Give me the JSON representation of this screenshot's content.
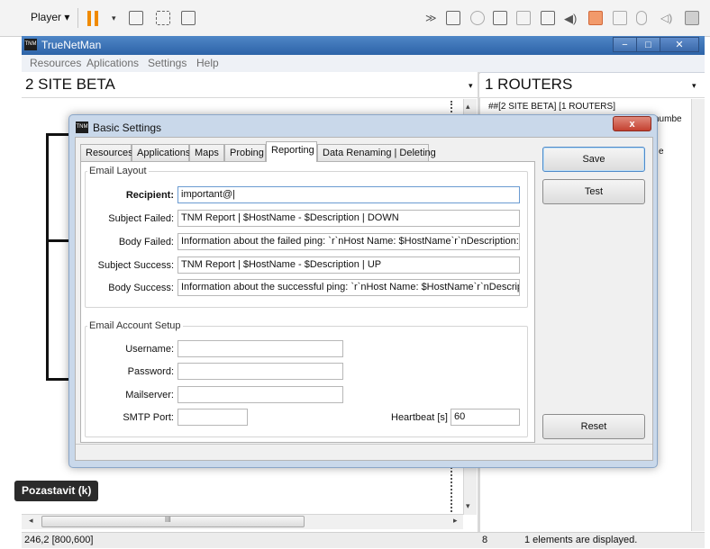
{
  "player": {
    "menu_label": "Player ▾",
    "icons": [
      "pause-icon",
      "dropdown-caret-icon",
      "network-icon",
      "fullscreen-icon",
      "window-icon",
      "forward-icon",
      "drive-icon",
      "disc-icon",
      "network-adapter-icon",
      "usb-icon",
      "display-icon",
      "sound-icon",
      "printer-icon",
      "webcam-icon",
      "bluetooth-icon",
      "volume-icon",
      "device-icon"
    ]
  },
  "app": {
    "title": "TrueNetMan",
    "logo_text": "TNM",
    "window_buttons": {
      "minimize": "−",
      "maximize": "□",
      "close": "✕"
    },
    "menu": [
      "Resources",
      "Aplications",
      "Settings",
      "Help"
    ]
  },
  "left_pane": {
    "title": "2 SITE BETA",
    "arrow": "▾"
  },
  "right_pane": {
    "title": "1 ROUTERS",
    "arrow": "▾",
    "first_line": "##[2 SITE BETA] [1 ROUTERS]",
    "partial_text_1": "numbe",
    "partial_text_2": "e"
  },
  "dialog": {
    "title": "Basic Settings",
    "logo_text": "TNM",
    "close_glyph": "x",
    "tabs": [
      "Resources",
      "Applications",
      "Maps",
      "Probing",
      "Reporting",
      "Data Renaming | Deleting"
    ],
    "active_tab": "Reporting",
    "email_layout": {
      "group_title": "Email Layout",
      "recipient_label": "Recipient:",
      "recipient_value": "important@|",
      "subject_failed_label": "Subject Failed:",
      "subject_failed_value": "TNM Report | $HostName - $Description | DOWN",
      "body_failed_label": "Body Failed:",
      "body_failed_value": "Information about the failed ping: `r`nHost Name: $HostName`r`nDescription: $D",
      "subject_success_label": "Subject Success:",
      "subject_success_value": "TNM Report | $HostName - $Description | UP",
      "body_success_label": "Body Success:",
      "body_success_value": "Information about the successful ping: `r`nHost Name: $HostName`r`nDescriptior"
    },
    "account_setup": {
      "group_title": "Email Account Setup",
      "username_label": "Username:",
      "username_value": "",
      "password_label": "Password:",
      "password_value": "",
      "mailserver_label": "Mailserver:",
      "mailserver_value": "",
      "smtp_label": "SMTP Port:",
      "smtp_value": "",
      "heartbeat_label": "Heartbeat [s]",
      "heartbeat_value": "60"
    },
    "buttons": {
      "save": "Save",
      "test": "Test",
      "reset": "Reset"
    }
  },
  "scroll": {
    "thumb_grip": "III",
    "left_arrow": "◂",
    "right_arrow": "▸",
    "up_arrow": "▴",
    "down_arrow": "▾"
  },
  "status": {
    "coords": "246,2 [800,600]",
    "count": "8",
    "message": "1 elements are displayed."
  },
  "tooltip": "Pozastavit (k)"
}
